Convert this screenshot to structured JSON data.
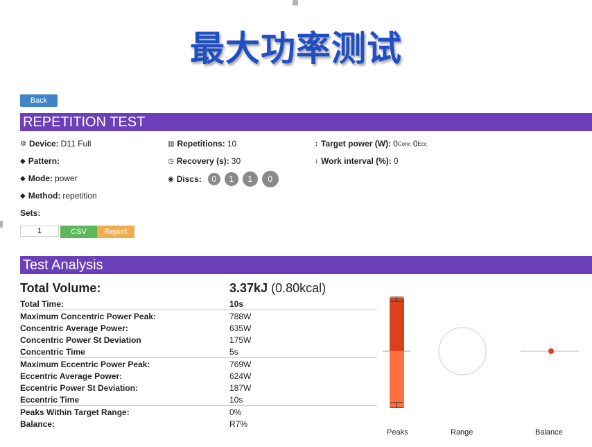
{
  "slide_title": "最大功率测试",
  "back_label": "Back",
  "section1_title": "REPETITION TEST",
  "device": {
    "label": "Device:",
    "value": "D11 Full"
  },
  "pattern": {
    "label": "Pattern:",
    "value": ""
  },
  "mode": {
    "label": "Mode:",
    "value": "power"
  },
  "method": {
    "label": "Method:",
    "value": "repetition"
  },
  "sets": {
    "label": "Sets:",
    "value": "1"
  },
  "repetitions": {
    "label": "Repetitions:",
    "value": "10"
  },
  "recovery": {
    "label": "Recovery (s):",
    "value": "30"
  },
  "discs": {
    "label": "Discs:",
    "values": [
      "0",
      "1",
      "1",
      "0"
    ]
  },
  "target_power": {
    "label": "Target power (W):",
    "conc_value": "0",
    "conc_sub": "Conc",
    "ecc_value": "0",
    "ecc_sub": "Ecc"
  },
  "work_interval": {
    "label": "Work interval (%):",
    "value": "0"
  },
  "csv_label": "CSV",
  "report_label": "Report",
  "section2_title": "Test Analysis",
  "total_volume": {
    "label": "Total Volume:",
    "value": "3.37kJ",
    "extra": "(0.80kcal)"
  },
  "stats": [
    {
      "label": "Total Time:",
      "value": "10s",
      "sep": false,
      "big": true
    },
    {
      "label": "Maximum Concentric Power Peak:",
      "value": "788W",
      "sep": true,
      "big": false
    },
    {
      "label": "Concentric Average Power:",
      "value": "635W",
      "sep": false,
      "big": false
    },
    {
      "label": "Concentric Power St Deviation",
      "value": "175W",
      "sep": false,
      "big": false
    },
    {
      "label": "Concentric Time",
      "value": "5s",
      "sep": false,
      "big": false
    },
    {
      "label": "Maximum Eccentric Power Peak:",
      "value": "769W",
      "sep": true,
      "big": false
    },
    {
      "label": "Eccentric Average Power:",
      "value": "624W",
      "sep": false,
      "big": false
    },
    {
      "label": "Eccentric Power St Deviation:",
      "value": "187W",
      "sep": false,
      "big": false
    },
    {
      "label": "Eccentric Time",
      "value": "10s",
      "sep": false,
      "big": false
    },
    {
      "label": "Peaks Within Target Range:",
      "value": "0%",
      "sep": true,
      "big": false
    },
    {
      "label": "Balance:",
      "value": "R7%",
      "sep": false,
      "big": false
    }
  ],
  "mini_charts": {
    "peaks_label": "Peaks",
    "range_label": "Range",
    "balance_label": "Balance",
    "peaks_upper_color": "#d9421c",
    "peaks_lower_color": "#ff7040",
    "balance_dot_color": "#d9421c"
  },
  "icons": {
    "device": "cogs-icon",
    "pattern": "tag-icon",
    "mode": "tag-icon",
    "method": "tag-icon",
    "repetitions": "bar-chart-icon",
    "recovery": "clock-icon",
    "discs": "radio-icon",
    "target_power": "vertical-resize-icon",
    "work_interval": "vertical-resize-icon"
  },
  "colors": {
    "section_bar": "#6b3fb8",
    "title": "#1f4fc4",
    "back": "#3e84c6",
    "csv": "#5cb85c",
    "report": "#f0ad4e"
  }
}
